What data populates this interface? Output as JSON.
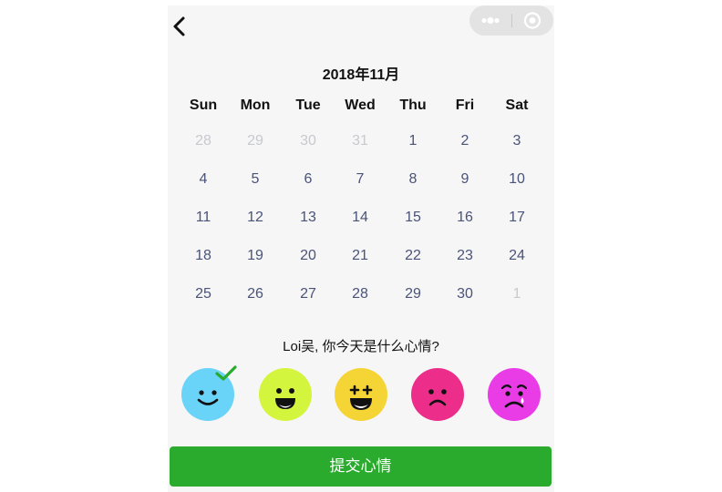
{
  "nav": {
    "back_icon": "chevron-left-icon",
    "capsule_more_icon": "more-dots-icon",
    "capsule_close_icon": "target-circle-icon"
  },
  "calendar": {
    "title": "2018年11月",
    "weekdays": [
      "Sun",
      "Mon",
      "Tue",
      "Wed",
      "Thu",
      "Fri",
      "Sat"
    ],
    "weeks": [
      [
        {
          "d": "28",
          "other": true
        },
        {
          "d": "29",
          "other": true
        },
        {
          "d": "30",
          "other": true
        },
        {
          "d": "31",
          "other": true
        },
        {
          "d": "1"
        },
        {
          "d": "2"
        },
        {
          "d": "3"
        }
      ],
      [
        {
          "d": "4"
        },
        {
          "d": "5"
        },
        {
          "d": "6"
        },
        {
          "d": "7"
        },
        {
          "d": "8"
        },
        {
          "d": "9"
        },
        {
          "d": "10"
        }
      ],
      [
        {
          "d": "11"
        },
        {
          "d": "12"
        },
        {
          "d": "13"
        },
        {
          "d": "14"
        },
        {
          "d": "15"
        },
        {
          "d": "16"
        },
        {
          "d": "17"
        }
      ],
      [
        {
          "d": "18"
        },
        {
          "d": "19"
        },
        {
          "d": "20"
        },
        {
          "d": "21"
        },
        {
          "d": "22"
        },
        {
          "d": "23"
        },
        {
          "d": "24"
        }
      ],
      [
        {
          "d": "25"
        },
        {
          "d": "26"
        },
        {
          "d": "27"
        },
        {
          "d": "28"
        },
        {
          "d": "29"
        },
        {
          "d": "30"
        },
        {
          "d": "1",
          "other": true
        }
      ]
    ]
  },
  "question": "Loi吴, 你今天是什么心情?",
  "moods": [
    {
      "name": "smile-face-icon",
      "color": "#6ad3f8",
      "selected": true
    },
    {
      "name": "grin-face-icon",
      "color": "#d4f53d",
      "selected": false
    },
    {
      "name": "excited-face-icon",
      "color": "#f5d535",
      "selected": false
    },
    {
      "name": "sad-face-icon",
      "color": "#ec2d8a",
      "selected": false
    },
    {
      "name": "worried-face-icon",
      "color": "#e93be6",
      "selected": false
    }
  ],
  "colors": {
    "accent": "#2aab2e",
    "check": "#2aab2e",
    "day_text": "#4a5378",
    "day_muted": "#c8c9cf"
  },
  "submit_label": "提交心情"
}
